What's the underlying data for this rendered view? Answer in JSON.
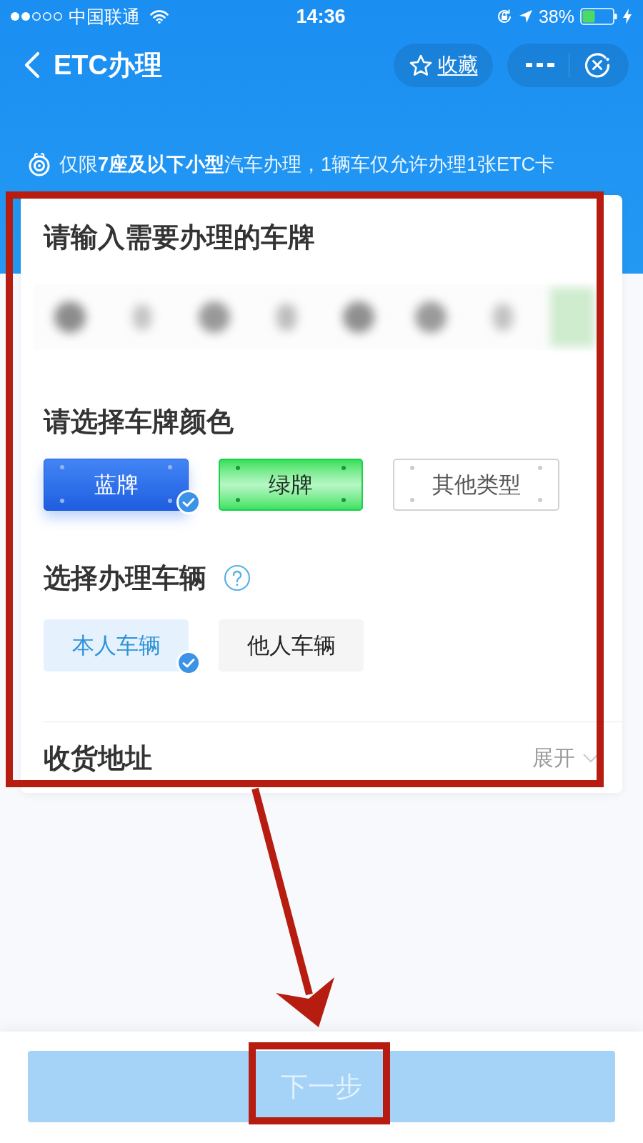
{
  "status_bar": {
    "carrier": "中国联通",
    "time": "14:36",
    "battery": "38%"
  },
  "header": {
    "title": "ETC办理",
    "favorite": "收藏"
  },
  "notice": "仅限**7座及以下小型**汽车办理，1辆车仅允许办理1张ETC卡",
  "plate_input": {
    "title": "请输入需要办理的车牌"
  },
  "plate_color": {
    "title": "请选择车牌颜色",
    "options": [
      {
        "label": "蓝牌",
        "kind": "blue",
        "selected": true
      },
      {
        "label": "绿牌",
        "kind": "green",
        "selected": false
      },
      {
        "label": "其他类型",
        "kind": "other",
        "selected": false
      }
    ]
  },
  "vehicle": {
    "title": "选择办理车辆",
    "options": [
      {
        "label": "本人车辆",
        "selected": true
      },
      {
        "label": "他人车辆",
        "selected": false
      }
    ]
  },
  "address": {
    "title": "收货地址",
    "toggle": "展开",
    "expanded": false
  },
  "next_button": {
    "label": "下一步",
    "disabled": true
  }
}
